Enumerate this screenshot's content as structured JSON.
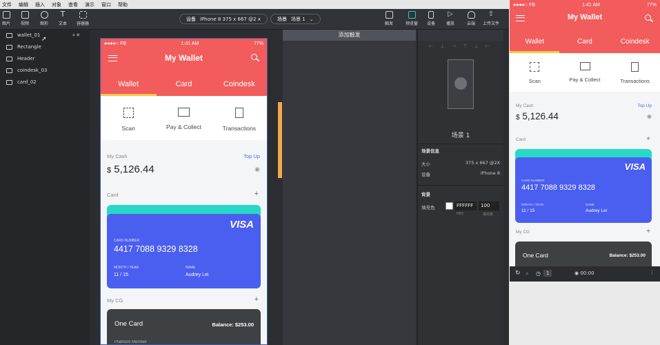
{
  "menu": [
    "文件",
    "编辑",
    "插入",
    "对象",
    "查看",
    "演示",
    "窗口",
    "帮助"
  ],
  "toolbar": {
    "left": [
      "图片",
      "视频",
      "图形",
      "文本",
      "容器器"
    ],
    "device_label": "设备",
    "device_value": "iPhone 8  375 x 667 @2 x",
    "scene_label": "场景",
    "scene_value": "场景 1",
    "right": [
      "触发",
      "预览窗",
      "设备",
      "播放",
      "云端",
      "上传文件"
    ]
  },
  "layers": [
    "wallet_01",
    "Rectangle",
    "Header",
    "coindesk_03",
    "card_02"
  ],
  "trigger": {
    "add": "添加触发"
  },
  "props": {
    "scene_name": "场景 1",
    "scene_info": "场景信息",
    "size_label": "大小",
    "size_value": "375 x 667 @2X",
    "device_label": "设备",
    "device_value": "iPhone 8",
    "bg_label": "背景",
    "fill_label": "填充色",
    "hex": "FFFFFF",
    "hex_caption": "HEX",
    "opacity": "100",
    "opacity_caption": "填充度"
  },
  "phone": {
    "carrier": "●●●●○ FB",
    "time": "1:41 AM",
    "battery": "77%",
    "title": "My Wallet",
    "tabs": [
      "Wallet",
      "Card",
      "Coindesk"
    ],
    "actions": [
      "Scan",
      "Pay & Collect",
      "Transactions"
    ],
    "cash_label": "My Cash",
    "top_up": "Top Up",
    "currency": "$",
    "cash": "5,126.44",
    "card_section": "Card",
    "plus": "+",
    "visa": "VISA",
    "card_number_label": "CARD NUMBER",
    "card_number": "4417   7088   9329   8328",
    "month_label": "MONTH / YEAR",
    "month": "11 / 15",
    "name_label": "NAME",
    "name": "Audrey Lei",
    "cg_section": "My CG",
    "one_card": "One Card",
    "balance": "Balance: $253.00",
    "premium": "Platinum Member"
  },
  "preview": {
    "carrier": "●●●●○ FB",
    "time": "1:41 AM",
    "battery": "77%",
    "play_time": "00:00",
    "speed": "1"
  },
  "colors": {
    "brand": "#f25c5c",
    "card": "#4a5ef0",
    "teal": "#28d8c6",
    "dark": "#3d4144",
    "accent": "#f7c843"
  }
}
